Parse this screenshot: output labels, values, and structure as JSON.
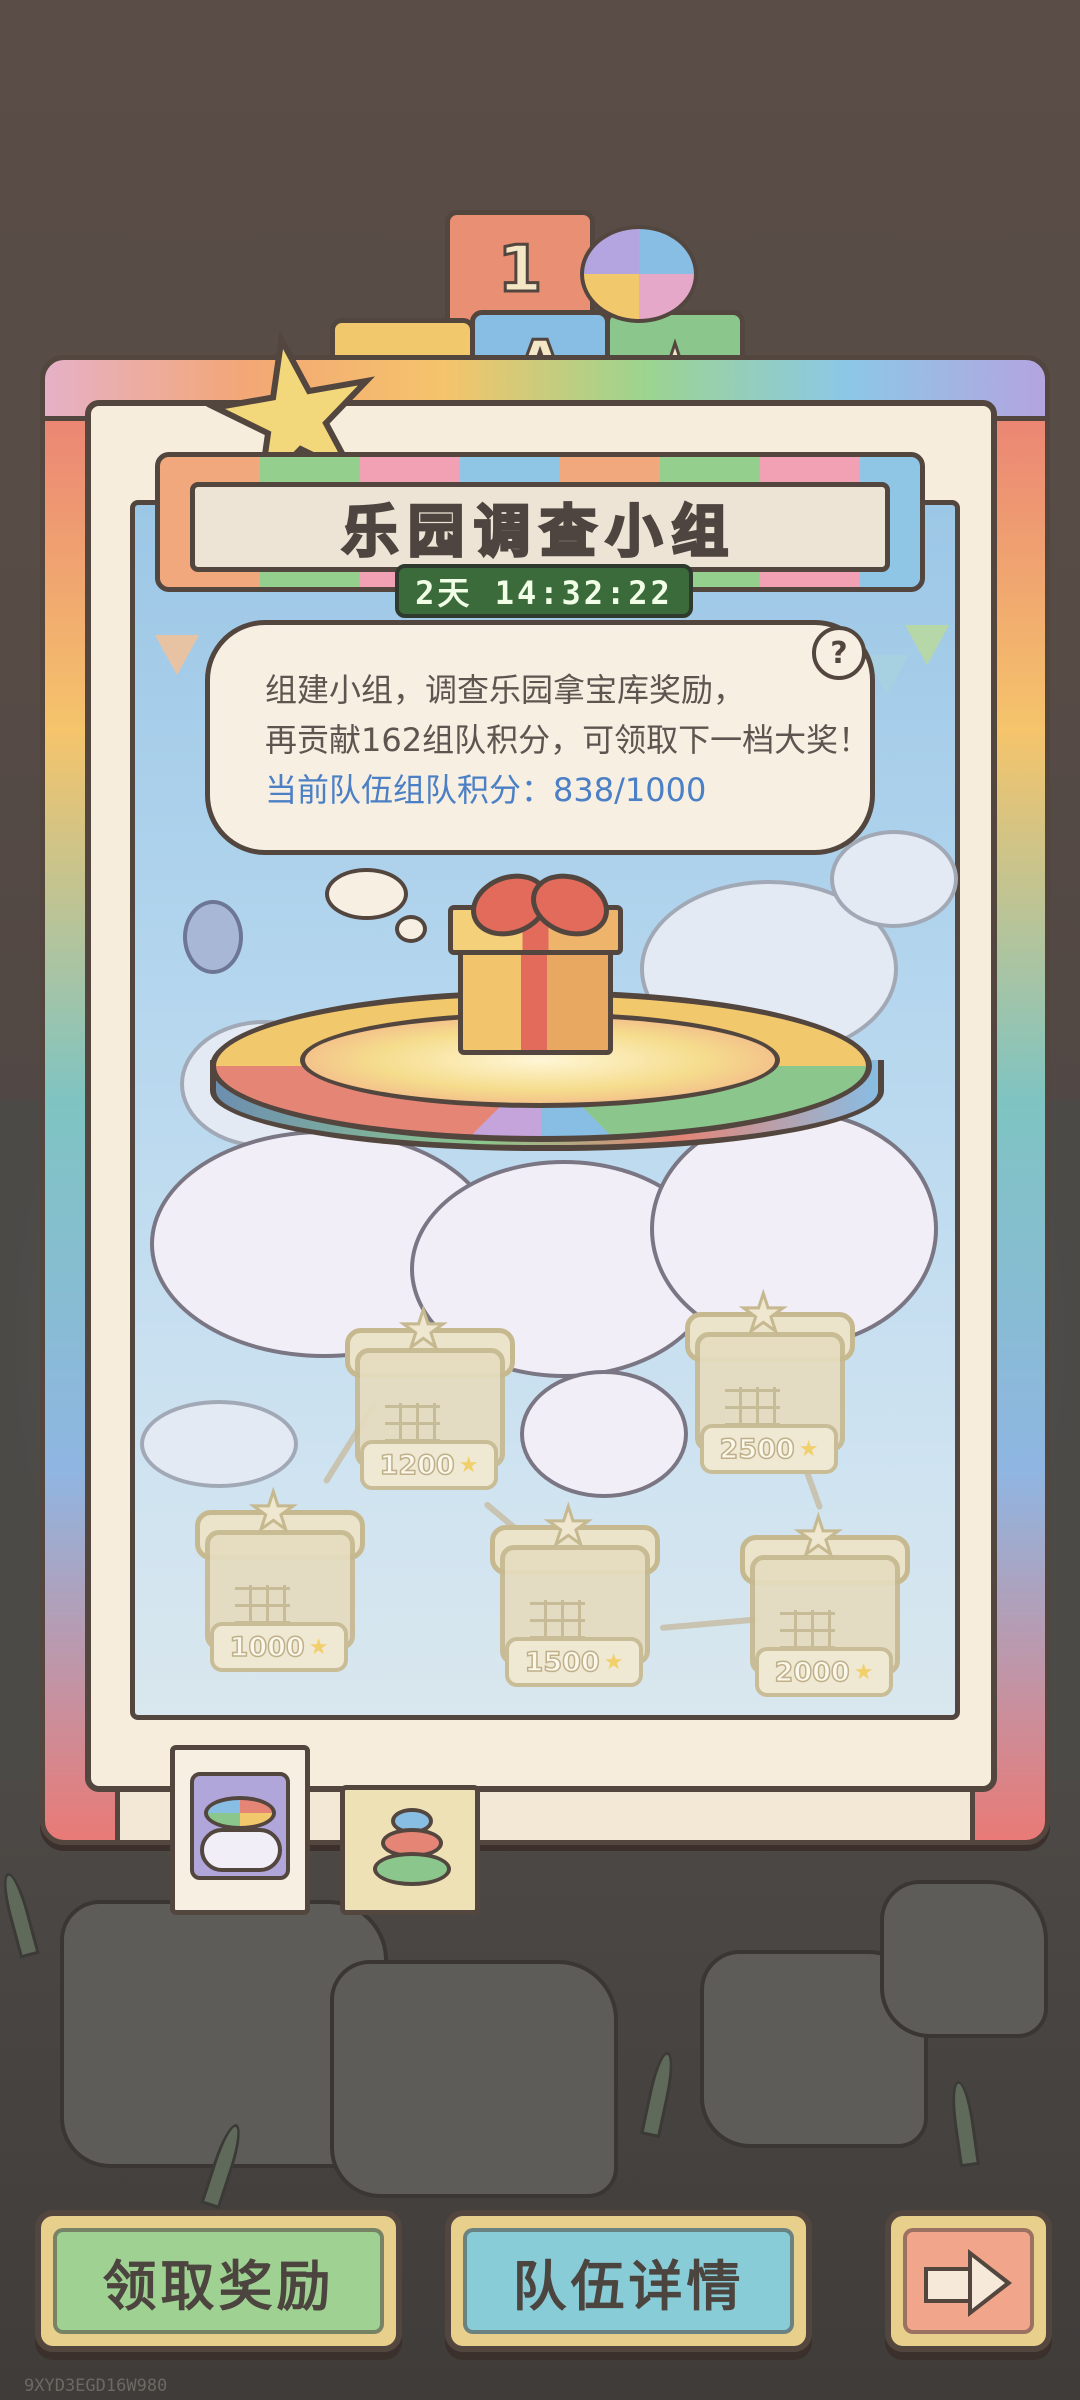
{
  "event": {
    "title": "乐园调查小组",
    "timer": "2天 14:32:22",
    "help_label": "?"
  },
  "bubble": {
    "line1": "组建小组，调查乐园拿宝库奖励，",
    "line2": "再贡献162组队积分，可领取下一档大奖！",
    "line3": "当前队伍组队积分：838/1000"
  },
  "blocks": {
    "top": "1",
    "middle": "A"
  },
  "rewards": [
    {
      "threshold": "1000",
      "claimed": false
    },
    {
      "threshold": "1200",
      "claimed": false
    },
    {
      "threshold": "1500",
      "claimed": false
    },
    {
      "threshold": "2000",
      "claimed": false
    },
    {
      "threshold": "2500",
      "claimed": false
    }
  ],
  "progress": {
    "current": 838,
    "target": 1000
  },
  "tabs": [
    {
      "icon": "cloud-platform-icon",
      "active": true
    },
    {
      "icon": "stacked-rings-icon",
      "active": false
    }
  ],
  "buttons": {
    "claim": "领取奖励",
    "team": "队伍详情",
    "next_icon": "arrow-right-icon"
  },
  "watermark": "9XYD3EGD16W980",
  "colors": {
    "outline": "#53463f",
    "link_text": "#4b7fc6",
    "timer_bg": "#3c6b3b",
    "claim_button": "#9fd192",
    "team_button": "#87ccd6",
    "next_button": "#f1a68b"
  }
}
